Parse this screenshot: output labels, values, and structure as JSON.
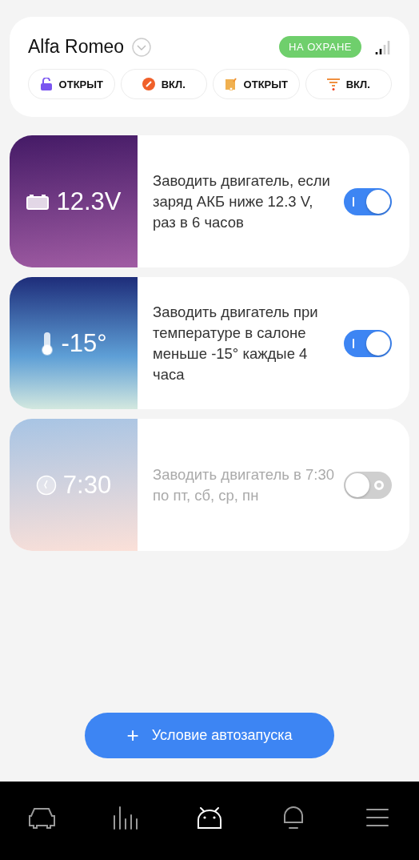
{
  "vehicle": {
    "name": "Alfa Romeo",
    "badge": "НА ОХРАНЕ"
  },
  "chips": [
    {
      "kind": "lock",
      "label": "ОТКРЫТ"
    },
    {
      "kind": "engine",
      "label": "ВКЛ."
    },
    {
      "kind": "trunk",
      "label": "ОТКРЫТ"
    },
    {
      "kind": "heater",
      "label": "ВКЛ."
    }
  ],
  "rules": [
    {
      "kind": "battery",
      "value": "12.3V",
      "text": "Заводить двигатель, если заряд АКБ ниже 12.3 V, раз в 6 часов",
      "on": true
    },
    {
      "kind": "temperature",
      "value": "-15°",
      "text": "Заводить двигатель при температуре в салоне меньше -15° каждые 4 часа",
      "on": true
    },
    {
      "kind": "time",
      "value": "7:30",
      "text": "Заводить двигатель в 7:30 по пт, сб, ср, пн",
      "on": false
    }
  ],
  "add_button": {
    "icon": "+",
    "label": "Условие автозапуска"
  },
  "nav": [
    {
      "kind": "car",
      "selected": false
    },
    {
      "kind": "stats",
      "selected": false
    },
    {
      "kind": "robot",
      "selected": true
    },
    {
      "kind": "bell",
      "selected": false
    },
    {
      "kind": "menu",
      "selected": false
    }
  ]
}
